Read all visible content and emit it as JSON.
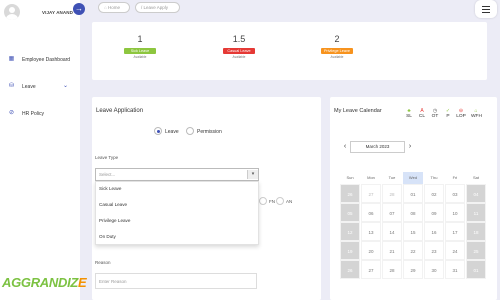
{
  "user": {
    "name": "VIJAY ANAND"
  },
  "sidebar": {
    "toggle_icon": "arrow-right-icon",
    "items": [
      {
        "label": "Employee Dashboard",
        "icon": "grid-icon"
      },
      {
        "label": "Leave",
        "icon": "bag-icon",
        "expandable": true
      },
      {
        "label": "HR Policy",
        "icon": "policy-icon"
      }
    ]
  },
  "brand": {
    "logo_text_pre": "AGGRANDIZ",
    "logo_text_post": "E"
  },
  "breadcrumb": {
    "home": "Home",
    "current": "Leave Apply"
  },
  "summary": [
    {
      "count": "1",
      "label": "Sick Leave",
      "caption": "Available",
      "color": "#8dc63f"
    },
    {
      "count": "1.5",
      "label": "Casual Leave",
      "caption": "Available",
      "color": "#e53935"
    },
    {
      "count": "2",
      "label": "Privilege Leave",
      "caption": "Available",
      "color": "#f7931e"
    }
  ],
  "application": {
    "title": "Leave Application",
    "radio_leave": "Leave",
    "radio_permission": "Permission",
    "leave_type_label": "Leave Type",
    "select_placeholder": "Select...",
    "options": [
      "Sick Leave",
      "Casual Leave",
      "Privilege Leave",
      "On Duty"
    ],
    "half_fn": "FN",
    "half_an": "AN",
    "reason_label": "Reason",
    "reason_placeholder": "Enter Reason"
  },
  "calendar": {
    "title": "My Leave Calendar",
    "legend": [
      {
        "code": "SL",
        "icon": "leaf-icon",
        "color": "#8dc63f"
      },
      {
        "code": "CL",
        "icon": "letter-a-icon",
        "color": "#e53935"
      },
      {
        "code": "OT",
        "icon": "clock-icon",
        "color": "#555555"
      },
      {
        "code": "P",
        "icon": "check-icon",
        "color": "#8dc63f"
      },
      {
        "code": "LOP",
        "icon": "minus-icon",
        "color": "#e53935"
      },
      {
        "code": "WFH",
        "icon": "home-icon",
        "color": "#8dc63f"
      }
    ],
    "month": "March 2023",
    "prev": "‹",
    "next": "›",
    "weekdays": [
      "Sun",
      "Mon",
      "Tue",
      "Wed",
      "Thu",
      "Fri",
      "Sat"
    ],
    "today_column": "Wed",
    "weeks": [
      [
        "26",
        "27",
        "28",
        "01",
        "02",
        "03",
        "04"
      ],
      [
        "05",
        "06",
        "07",
        "08",
        "09",
        "10",
        "11"
      ],
      [
        "12",
        "13",
        "14",
        "15",
        "16",
        "17",
        "18"
      ],
      [
        "19",
        "20",
        "21",
        "22",
        "23",
        "24",
        "25"
      ],
      [
        "26",
        "27",
        "28",
        "29",
        "30",
        "31",
        "01"
      ]
    ]
  }
}
